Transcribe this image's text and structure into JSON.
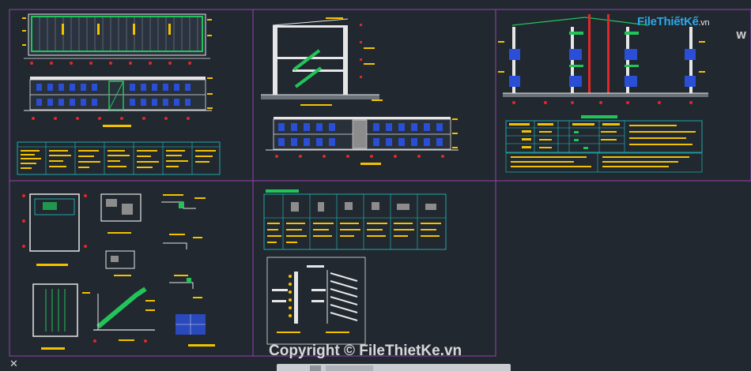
{
  "logo": {
    "brand": "FileThiếtKế",
    "domain": ".vn",
    "brand_color": "#2aa8e8"
  },
  "watermark": {
    "text": "Copyright © FileThietKe.vn"
  },
  "viewcube": {
    "label": "W"
  },
  "colors": {
    "background": "#212830",
    "frame": "#9b3fb0",
    "drawing_white": "#e6e6e6",
    "drawing_yellow": "#f2c200",
    "drawing_red": "#e02828",
    "drawing_green": "#22c45a",
    "drawing_cyan": "#22c6c6",
    "drawing_blue": "#2a4fd6",
    "drawing_gray": "#8c8c8c"
  },
  "icons": {
    "close": "close-icon",
    "viewcube": "viewcube-icon"
  }
}
